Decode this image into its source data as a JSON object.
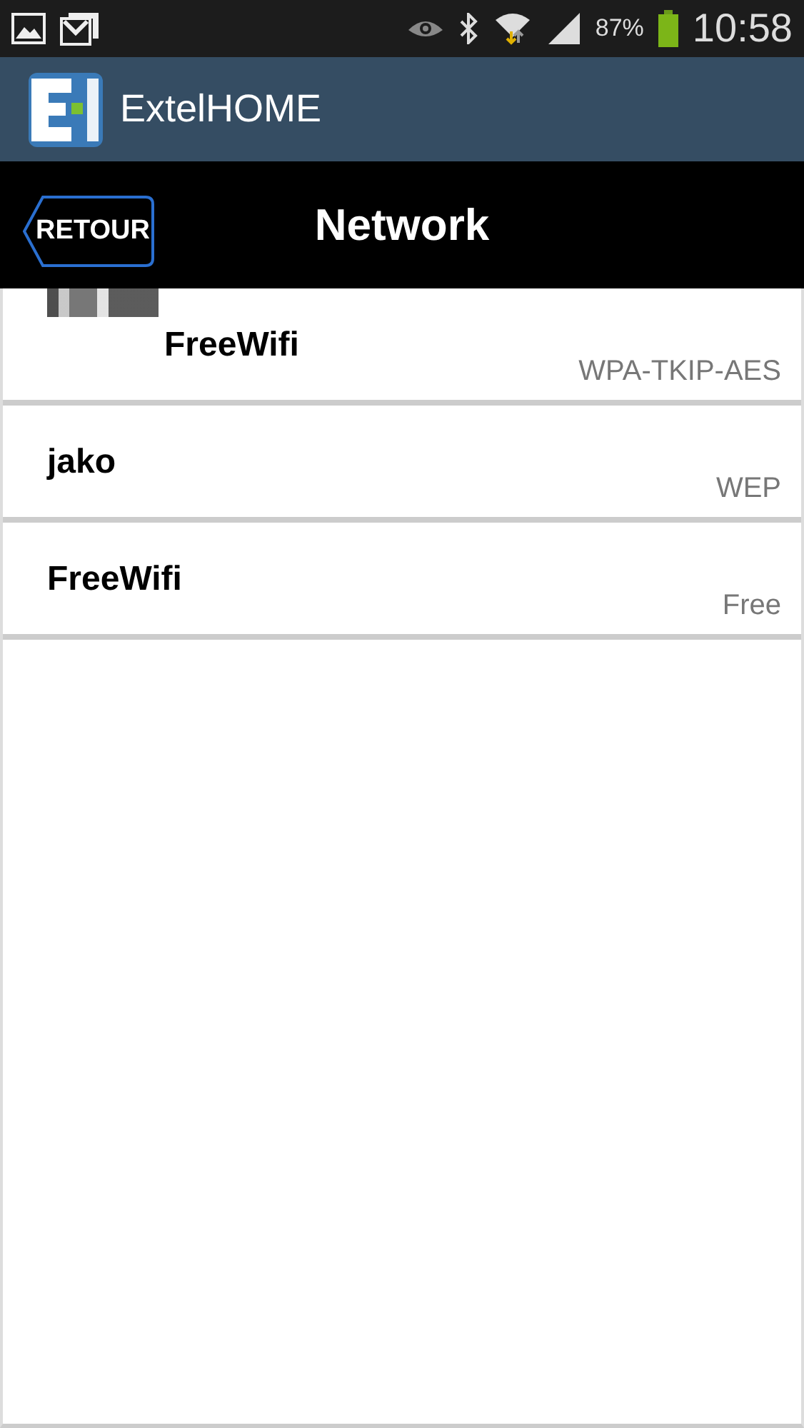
{
  "status_bar": {
    "battery_text": "87%",
    "time": "10:58"
  },
  "app_bar": {
    "title": "ExtelHOME"
  },
  "header": {
    "back_button": "RETOUR",
    "title": "Network"
  },
  "networks": [
    {
      "name": "FreeWifi",
      "security": "WPA-TKIP-AES",
      "redacted": true
    },
    {
      "name": "jako",
      "security": "WEP",
      "redacted": false
    },
    {
      "name": "FreeWifi",
      "security": "Free",
      "redacted": false
    }
  ]
}
